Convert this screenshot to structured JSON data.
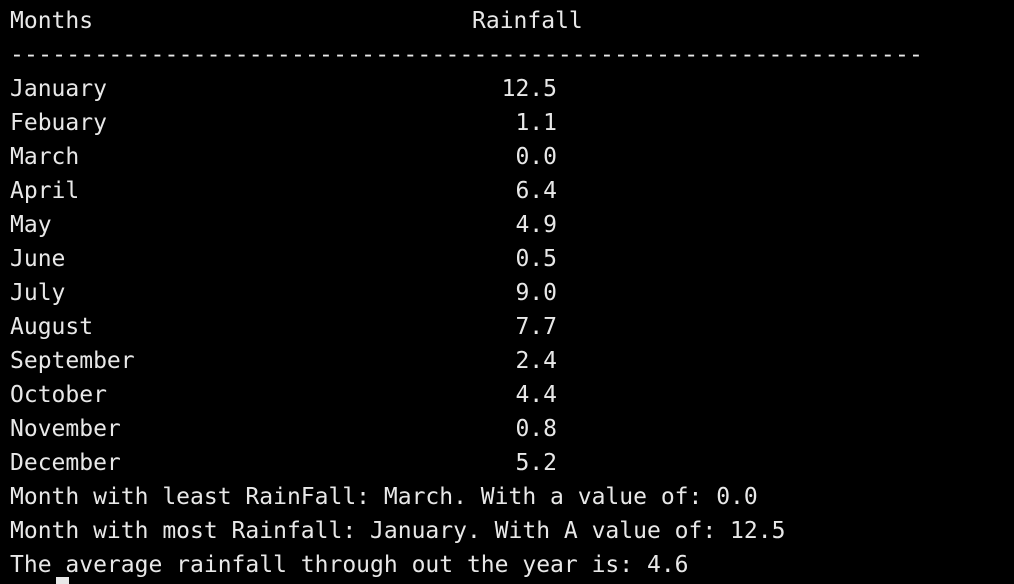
{
  "header": {
    "months_label": "Months",
    "rainfall_label": "Rainfall"
  },
  "separator": "-----------------------------------------------------------------",
  "rows": [
    {
      "month": "January",
      "rainfall": "12.5"
    },
    {
      "month": "Febuary",
      "rainfall": "1.1"
    },
    {
      "month": "March",
      "rainfall": "0.0"
    },
    {
      "month": "April",
      "rainfall": "6.4"
    },
    {
      "month": "May",
      "rainfall": "4.9"
    },
    {
      "month": "June",
      "rainfall": "0.5"
    },
    {
      "month": "July",
      "rainfall": "9.0"
    },
    {
      "month": "August",
      "rainfall": "7.7"
    },
    {
      "month": "September",
      "rainfall": "2.4"
    },
    {
      "month": "October",
      "rainfall": "4.4"
    },
    {
      "month": "November",
      "rainfall": "0.8"
    },
    {
      "month": "December",
      "rainfall": "5.2"
    }
  ],
  "summary": {
    "least": "Month with least RainFall: March. With a value of: 0.0",
    "most": "Month with most Rainfall: January. With A value of: 12.5",
    "average": "The average rainfall through out the year is: 4.6"
  },
  "colors": {
    "background": "#000000",
    "text": "#e8e8e8"
  }
}
